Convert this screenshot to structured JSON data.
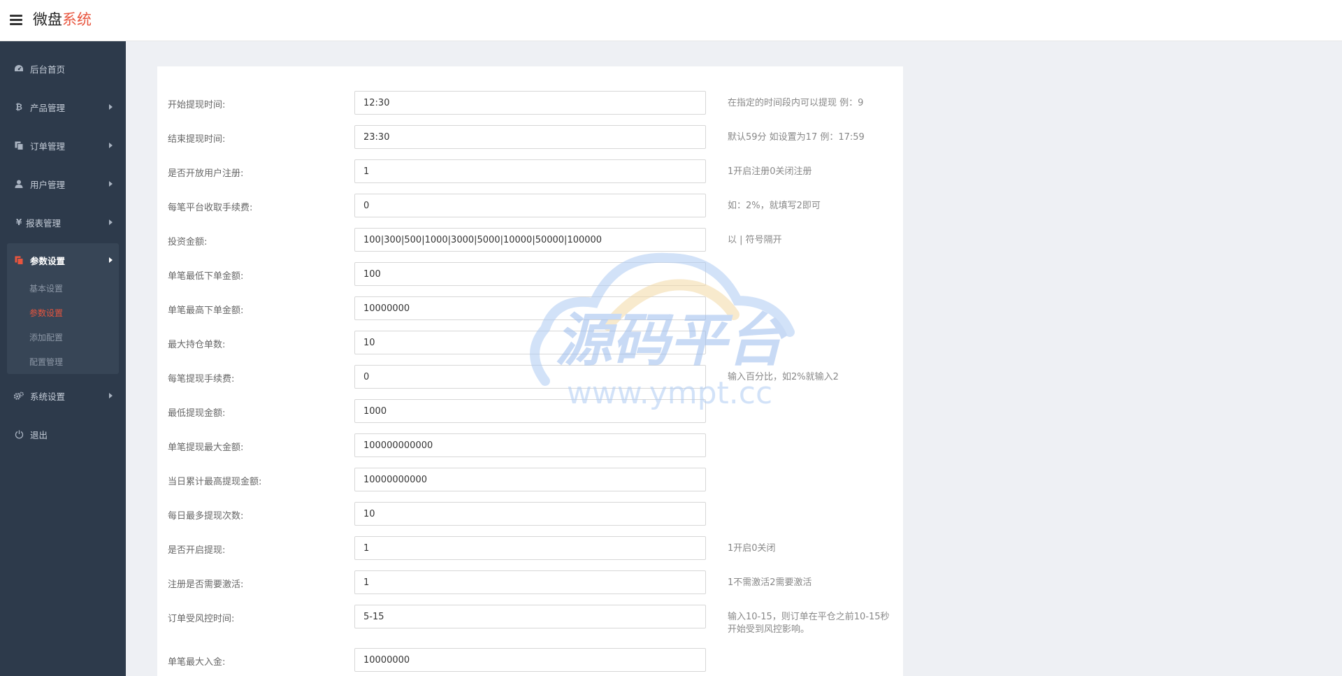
{
  "header": {
    "brand_part1": "微盘",
    "brand_part2": "系统"
  },
  "sidebar": {
    "items": [
      {
        "label": "后台首页",
        "icon": "dashboard-icon"
      },
      {
        "label": "产品管理",
        "icon": "bitcoin-icon"
      },
      {
        "label": "订单管理",
        "icon": "copy-icon"
      },
      {
        "label": "用户管理",
        "icon": "user-icon"
      },
      {
        "label": "报表管理",
        "icon": "yen-icon"
      },
      {
        "label": "参数设置",
        "icon": "files-icon"
      },
      {
        "label": "系统设置",
        "icon": "gears-icon"
      },
      {
        "label": "退出",
        "icon": "power-icon"
      }
    ],
    "submenu": [
      {
        "label": "基本设置"
      },
      {
        "label": "参数设置",
        "active": true
      },
      {
        "label": "添加配置"
      },
      {
        "label": "配置管理"
      }
    ]
  },
  "form": {
    "rows": [
      {
        "label": "开始提现时间:",
        "value": "12:30",
        "hint": "在指定的时间段内可以提现 例：9"
      },
      {
        "label": "结束提现时间:",
        "value": "23:30",
        "hint": "默认59分 如设置为17 例：17:59"
      },
      {
        "label": "是否开放用户注册:",
        "value": "1",
        "hint": "1开启注册0关闭注册"
      },
      {
        "label": "每笔平台收取手续费:",
        "value": "0",
        "hint": "如：2%，就填写2即可"
      },
      {
        "label": "投资金额:",
        "value": "100|300|500|1000|3000|5000|10000|50000|100000",
        "hint": "以 | 符号隔开"
      },
      {
        "label": "单笔最低下单金额:",
        "value": "100",
        "hint": ""
      },
      {
        "label": "单笔最高下单金额:",
        "value": "10000000",
        "hint": ""
      },
      {
        "label": "最大持仓单数:",
        "value": "10",
        "hint": ""
      },
      {
        "label": "每笔提现手续费:",
        "value": "0",
        "hint": "输入百分比，如2%就输入2"
      },
      {
        "label": "最低提现金额:",
        "value": "1000",
        "hint": ""
      },
      {
        "label": "单笔提现最大金额:",
        "value": "100000000000",
        "hint": ""
      },
      {
        "label": "当日累计最高提现金额:",
        "value": "10000000000",
        "hint": ""
      },
      {
        "label": "每日最多提现次数:",
        "value": "10",
        "hint": ""
      },
      {
        "label": "是否开启提现:",
        "value": "1",
        "hint": "1开启0关闭"
      },
      {
        "label": "注册是否需要激活:",
        "value": "1",
        "hint": "1不需激活2需要激活"
      },
      {
        "label": "订单受风控时间:",
        "value": "5-15",
        "hint": "输入10-15，则订单在平仓之前10-15秒",
        "hint2": "开始受到风控影响。"
      },
      {
        "label": "单笔最大入金:",
        "value": "10000000",
        "hint": ""
      }
    ]
  },
  "watermark": {
    "title": "源码平台",
    "url": "www.ympt.cc"
  },
  "colors": {
    "accent": "#e8553e",
    "sidebar_bg": "#2d3a4b",
    "sidebar_group_bg": "#374556",
    "page_bg": "#eef0f4"
  }
}
